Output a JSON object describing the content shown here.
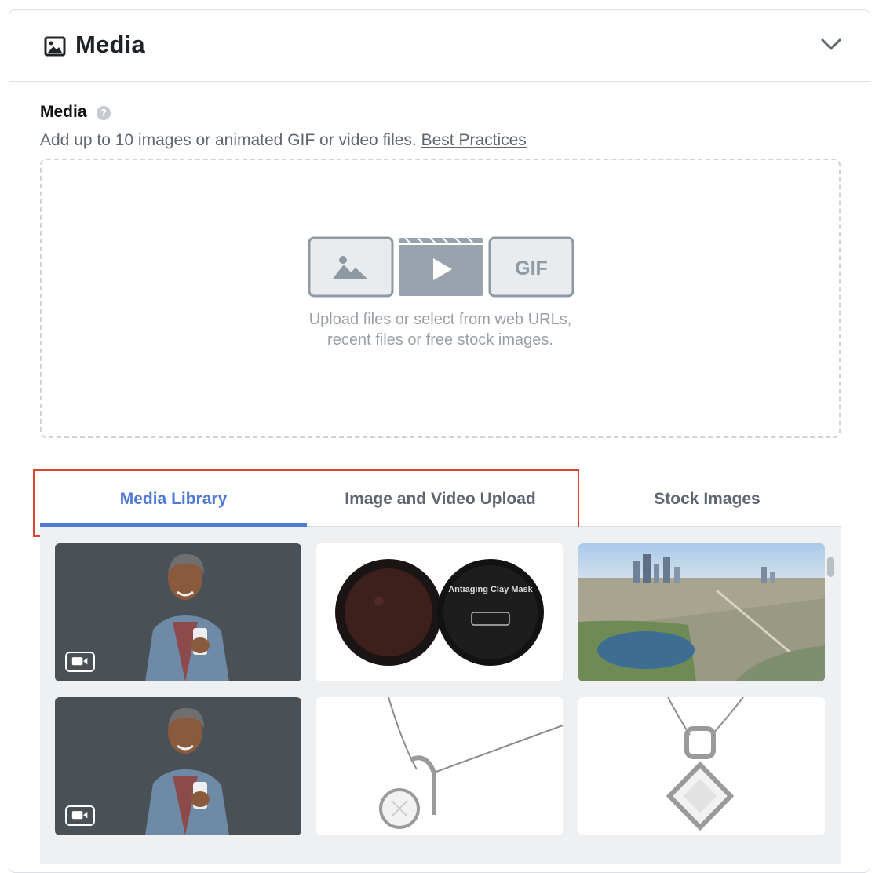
{
  "header": {
    "title": "Media",
    "icon": "image-icon",
    "collapse_icon": "chevron-down-icon"
  },
  "field": {
    "label": "Media",
    "help_icon": "question-icon",
    "help_glyph": "?",
    "helper_text": "Add up to 10 images or animated GIF or video files. ",
    "best_practices_link": "Best Practices"
  },
  "dropzone": {
    "line1": "Upload files or select from web URLs,",
    "line2": "recent files or free stock images.",
    "gif_label": "GIF"
  },
  "tabs": [
    {
      "label": "Media Library",
      "active": true
    },
    {
      "label": "Image and Video Upload",
      "active": false
    },
    {
      "label": "Stock Images",
      "active": false
    }
  ],
  "library": {
    "items": [
      {
        "name": "man-smiling-phone",
        "type": "video"
      },
      {
        "name": "antiaging-clay-mask",
        "type": "image",
        "jar_label": "Antiaging Clay Mask"
      },
      {
        "name": "city-aerial-lake",
        "type": "image"
      },
      {
        "name": "man-smiling-phone",
        "type": "video"
      },
      {
        "name": "diamond-pendant-round",
        "type": "image"
      },
      {
        "name": "diamond-pendant-square",
        "type": "image"
      }
    ]
  },
  "colors": {
    "accent": "#4e79d6",
    "highlight_border": "#e0432f"
  }
}
